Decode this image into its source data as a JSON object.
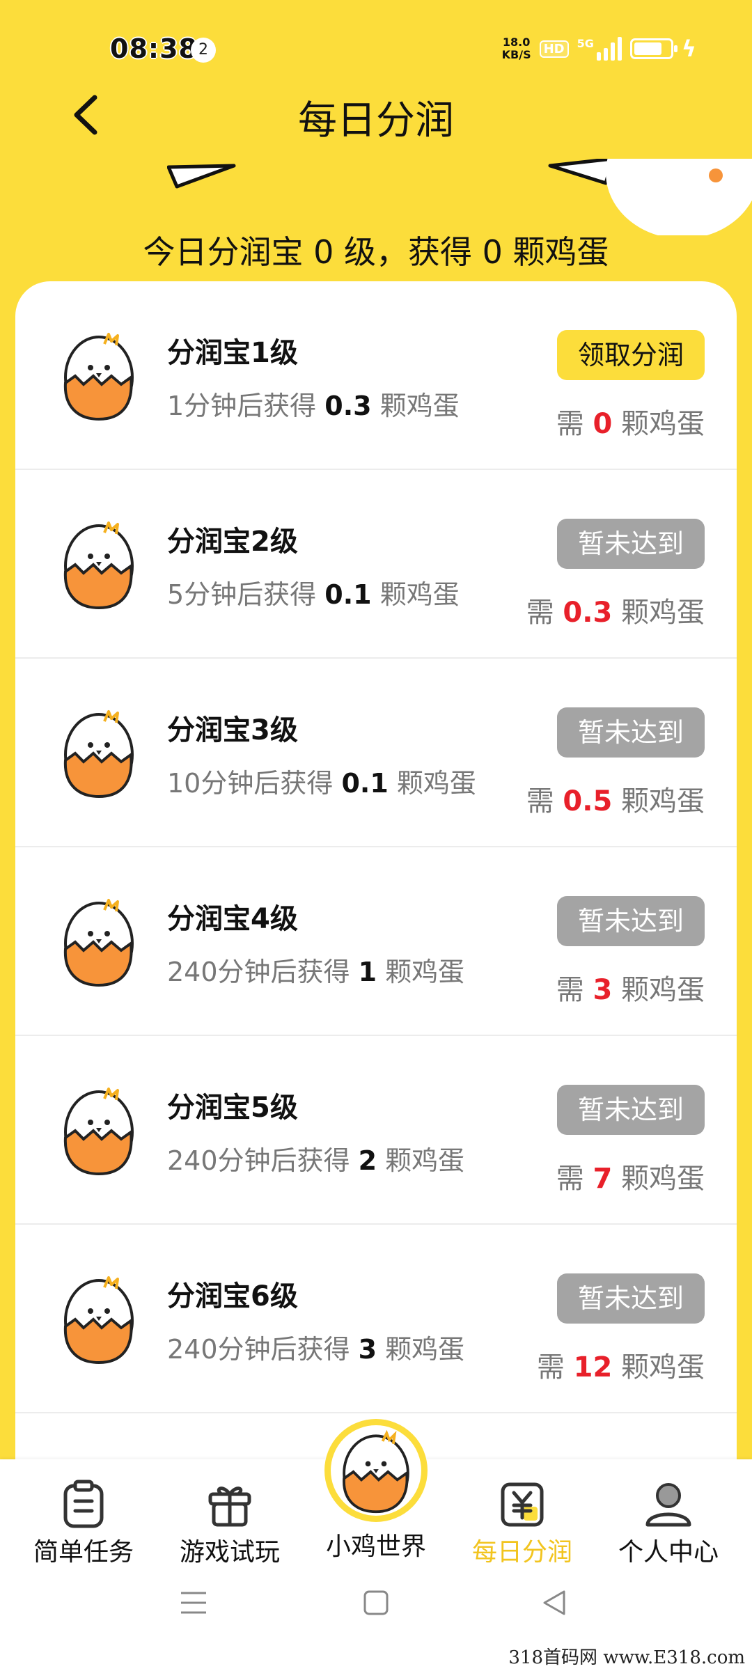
{
  "status_bar": {
    "time": "08:38",
    "notification_count": "2",
    "net_speed_value": "18.0",
    "net_speed_unit": "KB/S",
    "hd": "HD",
    "network": "5G"
  },
  "header": {
    "title": "每日分润"
  },
  "summary": "今日分润宝 0 级，获得 0 颗鸡蛋",
  "levels": [
    {
      "name": "分润宝1级",
      "desc_prefix": "1分钟后获得",
      "desc_amount": "0.3",
      "desc_suffix": "颗鸡蛋",
      "button": "领取分润",
      "active": true,
      "need_prefix": "需",
      "need_amount": "0",
      "need_suffix": "颗鸡蛋"
    },
    {
      "name": "分润宝2级",
      "desc_prefix": "5分钟后获得",
      "desc_amount": "0.1",
      "desc_suffix": "颗鸡蛋",
      "button": "暂未达到",
      "active": false,
      "need_prefix": "需",
      "need_amount": "0.3",
      "need_suffix": "颗鸡蛋"
    },
    {
      "name": "分润宝3级",
      "desc_prefix": "10分钟后获得",
      "desc_amount": "0.1",
      "desc_suffix": "颗鸡蛋",
      "button": "暂未达到",
      "active": false,
      "need_prefix": "需",
      "need_amount": "0.5",
      "need_suffix": "颗鸡蛋"
    },
    {
      "name": "分润宝4级",
      "desc_prefix": "240分钟后获得",
      "desc_amount": "1",
      "desc_suffix": "颗鸡蛋",
      "button": "暂未达到",
      "active": false,
      "need_prefix": "需",
      "need_amount": "3",
      "need_suffix": "颗鸡蛋"
    },
    {
      "name": "分润宝5级",
      "desc_prefix": "240分钟后获得",
      "desc_amount": "2",
      "desc_suffix": "颗鸡蛋",
      "button": "暂未达到",
      "active": false,
      "need_prefix": "需",
      "need_amount": "7",
      "need_suffix": "颗鸡蛋"
    },
    {
      "name": "分润宝6级",
      "desc_prefix": "240分钟后获得",
      "desc_amount": "3",
      "desc_suffix": "颗鸡蛋",
      "button": "暂未达到",
      "active": false,
      "need_prefix": "需",
      "need_amount": "12",
      "need_suffix": "颗鸡蛋"
    }
  ],
  "nav": {
    "items": [
      {
        "label": "简单任务",
        "icon": "clipboard-icon"
      },
      {
        "label": "游戏试玩",
        "icon": "gift-icon"
      },
      {
        "label": "小鸡世界",
        "icon": "chick-egg-icon"
      },
      {
        "label": "每日分润",
        "icon": "yuan-icon"
      },
      {
        "label": "个人中心",
        "icon": "user-icon"
      }
    ],
    "active_index": 3
  },
  "system_nav": {
    "menu": "menu-icon",
    "home": "home-icon",
    "back": "back-icon"
  },
  "watermark": "318首码网 www.E318.com",
  "colors": {
    "brand_yellow": "#FCDD3B",
    "disabled_gray": "#A4A4A4",
    "need_red": "#E8202A",
    "active_nav": "#F2C41E",
    "egg_orange": "#F7943A"
  }
}
